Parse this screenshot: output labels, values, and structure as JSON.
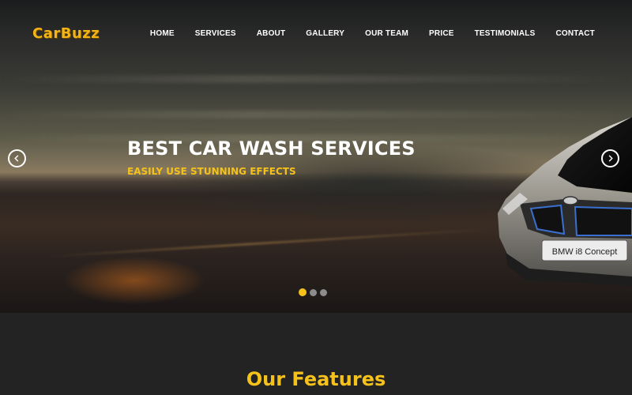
{
  "brand": {
    "logo": "CarBuzz"
  },
  "nav": {
    "items": [
      {
        "label": "HOME"
      },
      {
        "label": "SERVICES"
      },
      {
        "label": "ABOUT"
      },
      {
        "label": "GALLERY"
      },
      {
        "label": "OUR TEAM"
      },
      {
        "label": "PRICE"
      },
      {
        "label": "TESTIMONIALS"
      },
      {
        "label": "CONTACT"
      }
    ]
  },
  "hero": {
    "title": "BEST CAR WASH SERVICES",
    "subtitle": "EASILY USE STUNNING EFFECTS",
    "plate_text": "BMW i8 Concept",
    "slides_total": 3,
    "active_slide": 1
  },
  "features": {
    "title": "Our Features"
  },
  "colors": {
    "accent": "#f4c21a",
    "background": "#232323"
  }
}
